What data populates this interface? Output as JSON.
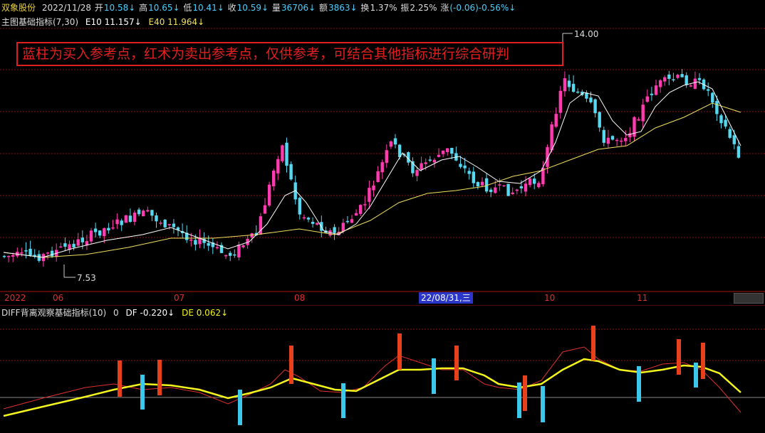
{
  "header": {
    "stock_name": "双象股份",
    "date": "2022/11/28",
    "open_label": "开",
    "open_value": "10.58↓",
    "high_label": "高",
    "high_value": "10.65↓",
    "low_label": "低",
    "low_value": "10.41↓",
    "close_label": "收",
    "close_value": "10.59↓",
    "volume_label": "量",
    "volume_value": "36706↓",
    "amount_label": "额",
    "amount_value": "3863↓",
    "turnover_label": "换",
    "turnover_value": "1.37%",
    "amplitude_label": "振",
    "amplitude_value": "2.25%",
    "change_label": "涨",
    "change_value": "(-0.06)-0.56%↓"
  },
  "main_indicator": {
    "name": "主图基础指标(7,30)",
    "e10_label": "E10",
    "e10_value": "11.157↓",
    "e40_label": "E40",
    "e40_value": "11.964↓"
  },
  "banner_text": "蓝柱为买入参考点，红术为卖出参考点，仅供参考，可结合其他指标进行综合研判",
  "price_labels": {
    "high": "14.00",
    "low": "7.53"
  },
  "date_axis": {
    "year": "2022",
    "months": [
      "06",
      "07",
      "08",
      "10",
      "11"
    ],
    "selected_date": "22/08/31,三"
  },
  "sub_indicator": {
    "name": "DIFF背离观察基础指标(10)",
    "zero": "0",
    "df_label": "DF",
    "df_value": "-0.220↓",
    "de_label": "DE",
    "de_value": "0.062↓"
  },
  "colors": {
    "up_candle": "#ff3bb0",
    "down_candle": "#55d8f0",
    "e10_line": "#ffffff",
    "e40_line": "#f0e060",
    "de_line": "#f5f51e",
    "sell_bar": "#e8401a",
    "buy_bar": "#3cc8ea",
    "grid": "#8a1010"
  }
}
